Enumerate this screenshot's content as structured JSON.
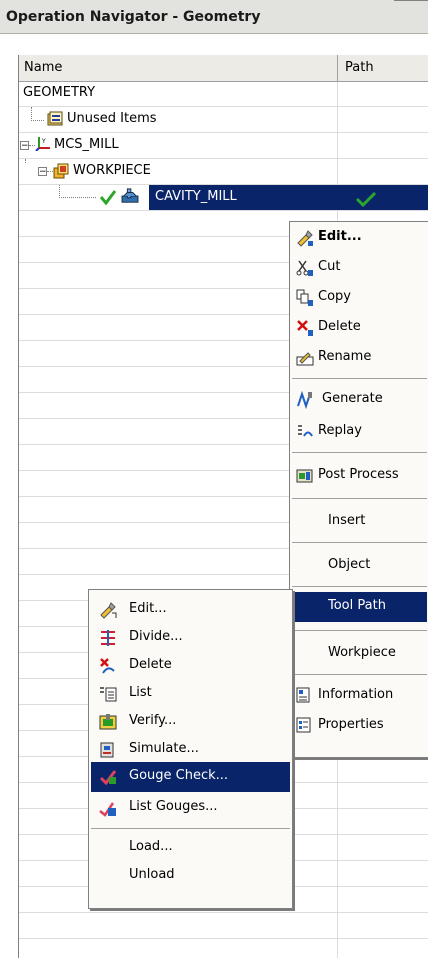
{
  "window": {
    "title": "Operation Navigator - Geometry"
  },
  "table": {
    "columns": [
      "Name",
      "Path"
    ],
    "rows": [
      {
        "name": "GEOMETRY",
        "icon": "none"
      },
      {
        "name": "Unused Items",
        "icon": "unused-items-icon"
      },
      {
        "name": "MCS_MILL",
        "icon": "mcs-icon"
      },
      {
        "name": "WORKPIECE",
        "icon": "workpiece-icon"
      },
      {
        "name": "CAVITY_MILL",
        "icon": "cavity-mill-icon",
        "status": "check",
        "selected": true
      }
    ]
  },
  "context_menu": {
    "items": [
      {
        "label": "Edit...",
        "bold": true,
        "icon": "edit-icon"
      },
      {
        "label": "Cut",
        "icon": "cut-icon"
      },
      {
        "label": "Copy",
        "icon": "copy-icon"
      },
      {
        "label": "Delete",
        "icon": "delete-icon"
      },
      {
        "label": "Rename",
        "icon": "rename-icon"
      },
      {
        "label": "Generate",
        "icon": "generate-icon"
      },
      {
        "label": "Replay",
        "icon": "replay-icon"
      },
      {
        "label": "Post Process",
        "icon": "post-process-icon"
      },
      {
        "label": "Insert",
        "icon": "none"
      },
      {
        "label": "Object",
        "icon": "none"
      },
      {
        "label": "Tool Path",
        "icon": "none",
        "highlighted": true
      },
      {
        "label": "Workpiece",
        "icon": "none"
      },
      {
        "label": "Information",
        "icon": "information-icon"
      },
      {
        "label": "Properties",
        "icon": "properties-icon"
      }
    ]
  },
  "submenu": {
    "items": [
      {
        "label": "Edit...",
        "icon": "edit-path-icon"
      },
      {
        "label": "Divide...",
        "icon": "divide-icon"
      },
      {
        "label": "Delete",
        "icon": "delete-path-icon"
      },
      {
        "label": "List",
        "icon": "list-icon"
      },
      {
        "label": "Verify...",
        "icon": "verify-icon"
      },
      {
        "label": "Simulate...",
        "icon": "simulate-icon"
      },
      {
        "label": "Gouge Check...",
        "icon": "gouge-check-icon",
        "highlighted": true
      },
      {
        "label": "List Gouges...",
        "icon": "list-gouges-icon"
      },
      {
        "label": "Load...",
        "icon": "none"
      },
      {
        "label": "Unload",
        "icon": "none"
      }
    ]
  },
  "colors": {
    "selection": "#0a246a",
    "header": "#ecebe6",
    "menu_bg": "#fbfaf7",
    "check": "#2aa62a"
  }
}
